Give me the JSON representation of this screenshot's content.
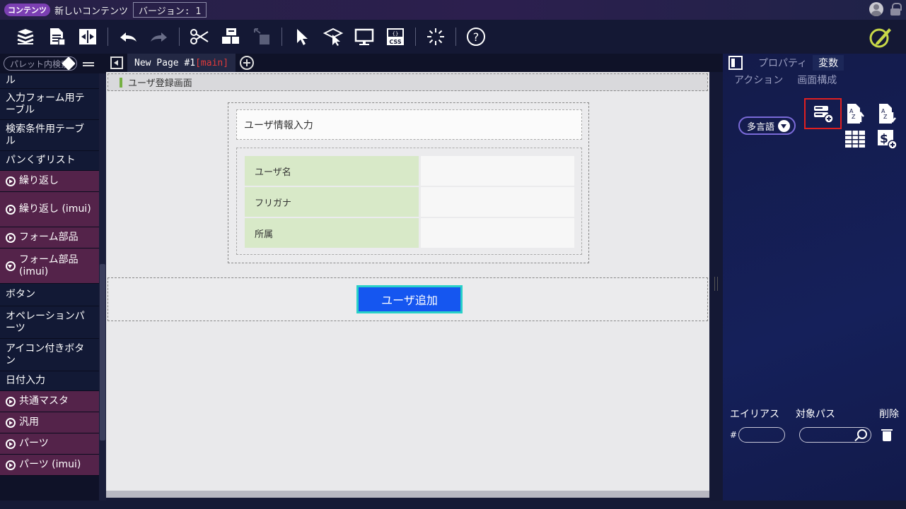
{
  "titlebar": {
    "badge": "コンテンツ",
    "title": "新しいコンテンツ",
    "version": "バージョン: 1"
  },
  "toolbar": {
    "icons": [
      "db-icon",
      "form-file-icon",
      "split-icon",
      "undo-icon",
      "redo-icon",
      "cut-icon",
      "component-icon",
      "component-disabled-icon",
      "select-icon",
      "cursor-box-icon",
      "monitor-icon",
      "css-icon",
      "loading-icon",
      "help-icon",
      "pen-icon"
    ]
  },
  "palette": {
    "search_placeholder": "パレット内検索",
    "items": [
      {
        "label": "ル",
        "type": "plain"
      },
      {
        "label": "入力フォーム用テーブル",
        "type": "plain"
      },
      {
        "label": "検索条件用テーブル",
        "type": "plain"
      },
      {
        "label": "パンくずリスト",
        "type": "plain"
      },
      {
        "label": "繰り返し",
        "type": "group"
      },
      {
        "label": "繰り返し (imui)",
        "type": "group"
      },
      {
        "label": "フォーム部品",
        "type": "group"
      },
      {
        "label": "フォーム部品 (imui)",
        "type": "group-open"
      },
      {
        "label": "ボタン",
        "type": "plain"
      },
      {
        "label": "オペレーションパーツ",
        "type": "plain"
      },
      {
        "label": "アイコン付きボタン",
        "type": "plain"
      },
      {
        "label": "日付入力",
        "type": "plain"
      },
      {
        "label": "共通マスタ",
        "type": "group"
      },
      {
        "label": "汎用",
        "type": "group"
      },
      {
        "label": "パーツ",
        "type": "group"
      },
      {
        "label": "パーツ (imui)",
        "type": "group"
      }
    ]
  },
  "tabs": {
    "page_name": "New Page #1",
    "page_tag": "[main]"
  },
  "canvas": {
    "screen_title": "ユーザ登録画面",
    "form_title": "ユーザ情報入力",
    "fields": [
      "ユーザ名",
      "フリガナ",
      "所属"
    ],
    "add_button": "ユーザ追加"
  },
  "right_panel": {
    "tab_property": "プロパティ",
    "tab_variable": "変数",
    "tab_action": "アクション",
    "tab_layout": "画面構成",
    "lang_button": "多言語",
    "col_alias": "エイリアス",
    "col_path": "対象パス",
    "col_delete": "削除",
    "row_prefix": "#"
  },
  "colors": {
    "accent": "#1556f0",
    "accent_border": "#29d0c8",
    "palette_group": "#54234a",
    "field_label_bg": "#d8e9c8",
    "highlight": "#e02020"
  }
}
